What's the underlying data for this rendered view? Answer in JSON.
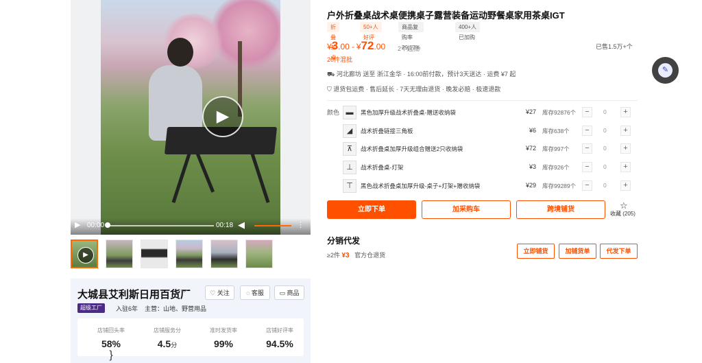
{
  "media": {
    "video": {
      "time_current": "00:00",
      "time_total": "00:18"
    },
    "thumbnails": [
      "thumb-video",
      "thumb-2",
      "thumb-3",
      "thumb-4",
      "thumb-5",
      "thumb-6"
    ]
  },
  "store": {
    "name": "大城县艾利斯日用百货厂",
    "follow_label": "关注",
    "service_label": "客服",
    "goods_label": "商品",
    "badge": "超级工厂",
    "years": "入驻6年",
    "main_business": "主营：山地、野营用品",
    "stats": [
      {
        "label": "店铺回头率",
        "value": "58%",
        "unit": ""
      },
      {
        "label": "店铺服务分",
        "value": "4.5",
        "unit": "分"
      },
      {
        "label": "准时发货率",
        "value": "99%",
        "unit": ""
      },
      {
        "label": "店铺好评率",
        "value": "94.5%",
        "unit": ""
      }
    ]
  },
  "product": {
    "title": "户外折叠桌战术桌便携桌子露营装备运动野餐桌家用茶桌IGT",
    "tags": [
      "折叠茶桌",
      "50+人好评",
      "商品复购率29.17%",
      "400+人已加购"
    ],
    "price": {
      "currency": "¥",
      "min_int": "3",
      "min_dec": ".00",
      "separator": "-",
      "max_int": "72",
      "max_dec": ".00"
    },
    "moq": "2个起批",
    "sold": "已售1.5万+个",
    "mixed": "20件混批",
    "shipping": "河北廊坊 送至 浙江金华  ·  16:00前付款，预计3天送达  ·  运费 ¥7 起",
    "services": "退货包运费 · 售后延长 · 7天无理由退货 · 晚发必赔 · 极速退款",
    "color_label": "颜色",
    "variants": [
      {
        "name": "黑色加厚升级战术折叠桌-赠送收纳袋",
        "price": "¥27",
        "stock": "库存92876个",
        "qty": "0"
      },
      {
        "name": "战术折叠链接三角板",
        "price": "¥6",
        "stock": "库存638个",
        "qty": "0"
      },
      {
        "name": "战术折叠桌加厚升级组合赠送2只收纳袋",
        "price": "¥72",
        "stock": "库存997个",
        "qty": "0"
      },
      {
        "name": "战术折叠桌-灯架",
        "price": "¥3",
        "stock": "库存926个",
        "qty": "0"
      },
      {
        "name": "黑色战术折叠桌加厚升级-桌子+灯架+赠收纳袋",
        "price": "¥29",
        "stock": "库存99289个",
        "qty": "0"
      }
    ],
    "actions": {
      "buy": "立即下单",
      "cart": "加采购车",
      "cross": "跨境铺货",
      "fav": "收藏 (205)"
    }
  },
  "distribution": {
    "title": "分销代发",
    "min_qty": "≥2件",
    "price": "¥3",
    "warehouse": "官方仓退货",
    "buttons": [
      "立即铺货",
      "加铺货单",
      "代发下单"
    ]
  },
  "colors": {
    "accent": "#ff5000",
    "store_bg": "#f1f4fb",
    "badge": "#4b2b86"
  }
}
